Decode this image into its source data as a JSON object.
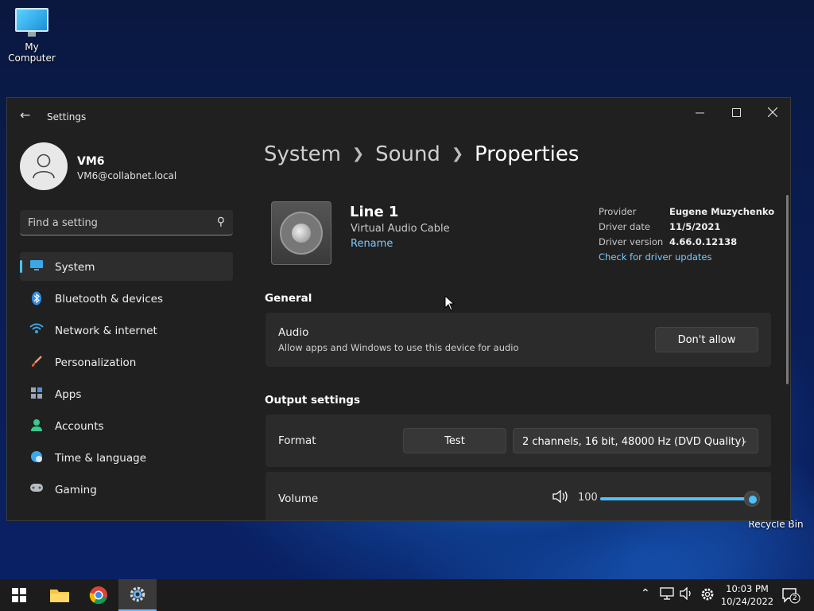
{
  "desktop": {
    "my_computer_label": "My Computer",
    "recycle_bin_label": "Recycle Bin"
  },
  "window": {
    "title": "Settings",
    "minimize_icon": "minimize-icon",
    "maximize_icon": "maximize-icon",
    "close_icon": "close-icon"
  },
  "profile": {
    "name": "VM6",
    "email": "VM6@collabnet.local"
  },
  "search": {
    "placeholder": "Find a setting"
  },
  "sidebar": {
    "items": [
      {
        "label": "System",
        "icon": "system-icon",
        "active": true
      },
      {
        "label": "Bluetooth & devices",
        "icon": "bluetooth-icon"
      },
      {
        "label": "Network & internet",
        "icon": "wifi-icon"
      },
      {
        "label": "Personalization",
        "icon": "brush-icon"
      },
      {
        "label": "Apps",
        "icon": "apps-icon"
      },
      {
        "label": "Accounts",
        "icon": "person-icon"
      },
      {
        "label": "Time & language",
        "icon": "globe-icon"
      },
      {
        "label": "Gaming",
        "icon": "gamepad-icon"
      }
    ]
  },
  "breadcrumb": {
    "items": [
      "System",
      "Sound"
    ],
    "current": "Properties"
  },
  "device": {
    "name": "Line 1",
    "subtitle": "Virtual Audio Cable",
    "rename_label": "Rename"
  },
  "driver": {
    "provider_label": "Provider",
    "provider_value": "Eugene Muzychenko",
    "date_label": "Driver date",
    "date_value": "11/5/2021",
    "version_label": "Driver version",
    "version_value": "4.66.0.12138",
    "update_link": "Check for driver updates"
  },
  "general": {
    "heading": "General",
    "audio_title": "Audio",
    "audio_desc": "Allow apps and Windows to use this device for audio",
    "audio_button": "Don't allow"
  },
  "output": {
    "heading": "Output settings",
    "format_label": "Format",
    "test_button": "Test",
    "format_value": "2 channels, 16 bit, 48000 Hz (DVD Quality)",
    "volume_label": "Volume",
    "volume_value": "100"
  },
  "taskbar": {
    "time": "10:03 PM",
    "date": "10/24/2022",
    "notification_count": "2"
  },
  "colors": {
    "accent": "#4cc2ff",
    "link": "#7cc9ff",
    "window_bg": "#202020",
    "card_bg": "#2b2b2b"
  }
}
